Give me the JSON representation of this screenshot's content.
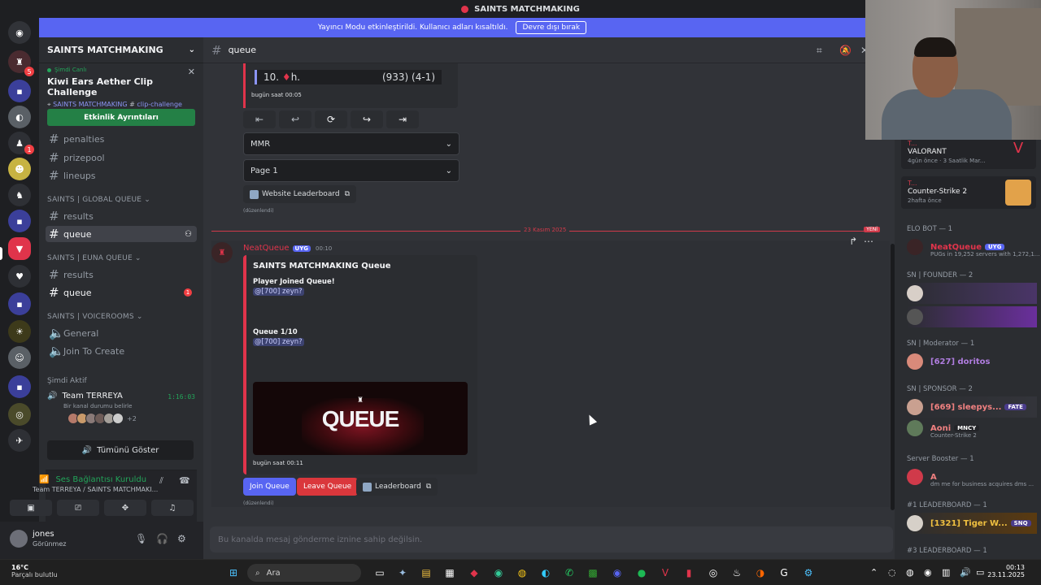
{
  "window": {
    "title": "SAINTS MATCHMAKING"
  },
  "banner": {
    "text": "Yayıncı Modu etkinleştirildi. Kullanıcı adları kısaltıldı.",
    "button": "Devre dışı bırak"
  },
  "rail": {
    "badges": [
      "5",
      "1"
    ]
  },
  "sidebar": {
    "server_name": "SAINTS MATCHMAKING",
    "event": {
      "live": "Şimdi Canlı",
      "title": "Kiwi Ears Aether Clip Challenge",
      "server": "SAINTS MATCHMAKING",
      "channel": "clip-challenge",
      "button": "Etkinlik Ayrıntıları"
    },
    "channels_top": [
      "penalties",
      "prizepool",
      "lineups"
    ],
    "cat_global": "SAINTS | GLOBAL QUEUE",
    "global": [
      "results",
      "queue"
    ],
    "cat_euna": "SAINTS | EUNA QUEUE",
    "euna": [
      "results",
      "queue"
    ],
    "euna_badge": "1",
    "cat_voice": "SAINTS | VOICEROOMS",
    "voice": [
      "General",
      "Join To Create"
    ],
    "now_active": "Şimdi Aktif",
    "team": {
      "name": "Team TERREYA",
      "time": "1:16:03",
      "status": "Bir kanal durumu belirle",
      "more": "+2"
    },
    "show_all": "Tümünü Göster"
  },
  "voice_panel": {
    "status": "Ses Bağlantısı Kuruldu",
    "location": "Team TERREYA / SAINTS MATCHMAKI..."
  },
  "user": {
    "name": "jones",
    "status": "Görünmez"
  },
  "channel": {
    "name": "queue"
  },
  "leaderboard_embed": {
    "rank": "10.",
    "name": "h.",
    "score": "(933) (4-1)",
    "time": "bugün saat 00:05"
  },
  "controls": {
    "mmr": "MMR",
    "page": "Page 1",
    "website": "Website Leaderboard",
    "edited": "(düzenlendi)"
  },
  "divider": {
    "date": "23 Kasım 2025",
    "new": "YENİ"
  },
  "message": {
    "author": "NeatQueue",
    "tag": "UYG",
    "time": "00:10",
    "embed_title": "SAINTS MATCHMAKING Queue",
    "field1": "Player Joined Queue!",
    "mention1": "@[700] zeyn?",
    "field2": "Queue 1/10",
    "mention2": "@[700] zeyn?",
    "image_text": "QUEUE",
    "embed_time": "bugün saat 00:11",
    "join": "Join Queue",
    "leave": "Leave Queue",
    "leaderboard": "Leaderboard",
    "edited": "(düzenlendi)"
  },
  "input": {
    "placeholder": "Bu kanalda mesaj gönderme iznine sahip değilsin."
  },
  "members": {
    "activities": [
      {
        "server": "T...",
        "game": "VALORANT",
        "time": "4gün önce",
        "extra": "3 Saatlik Mar..."
      },
      {
        "server": "T...",
        "game": "Counter-Strike 2",
        "time": "2hafta önce"
      }
    ],
    "sections": [
      {
        "label": "ELO BOT — 1"
      },
      {
        "label": "SN | FOUNDER — 2"
      },
      {
        "label": "SN | Moderator — 1"
      },
      {
        "label": "SN | SPONSOR — 2"
      },
      {
        "label": "Server Booster — 1"
      },
      {
        "label": "#1 LEADERBOARD — 1"
      },
      {
        "label": "#3 LEADERBOARD — 1"
      }
    ],
    "elo": {
      "name": "NeatQueue",
      "tag": "UYG",
      "sub": "PUGs in 19,252 servers with 1,272,1..."
    },
    "mod": {
      "name": "[627] doritos"
    },
    "sponsor1": {
      "name": "[669] sleepys...",
      "badge": "FATE"
    },
    "sponsor2": {
      "name": "Aoni",
      "badge": "MNCY",
      "sub": "Counter-Strike 2"
    },
    "booster": {
      "name": "A",
      "sub": "dm me for business acquires dms ..."
    },
    "lb1": {
      "name": "[1321] Tiger W...",
      "badge": "SNQ"
    }
  },
  "taskbar": {
    "temp": "16°C",
    "weather": "Parçalı bulutlu",
    "search": "Ara",
    "time": "00:13",
    "date": "23.11.2025"
  }
}
